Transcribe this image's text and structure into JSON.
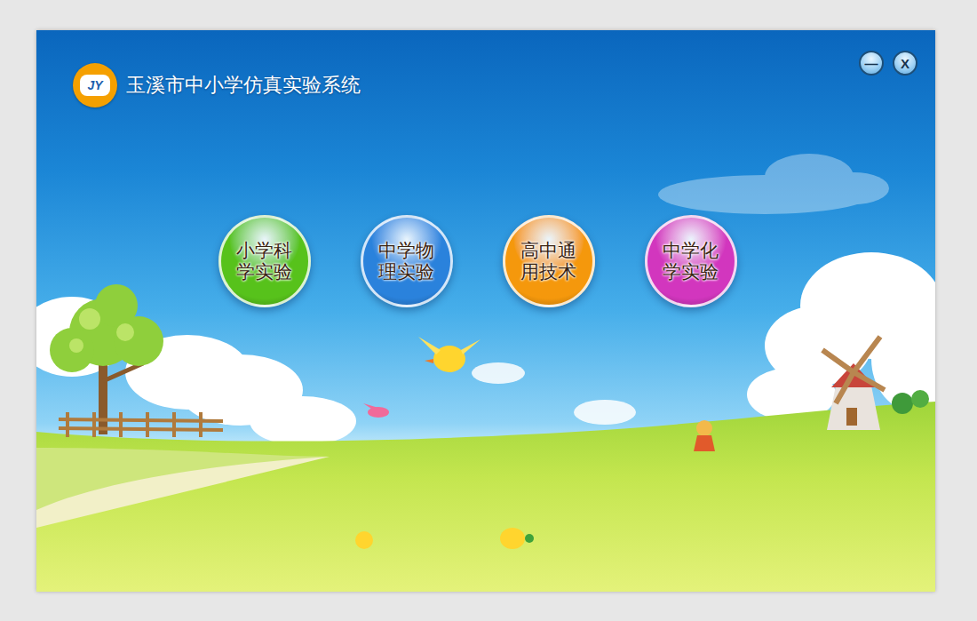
{
  "window": {
    "title": "玉溪市中小学仿真实验系统",
    "logo": "JY"
  },
  "controls": [
    {
      "label": "—"
    },
    {
      "label": "X"
    }
  ],
  "menu": [
    {
      "label": "小学科学实验",
      "color": "#57c21b"
    },
    {
      "label": "中学物理实验",
      "color": "#2a82dc"
    },
    {
      "label": "高中通用技术",
      "color": "#f5980c"
    },
    {
      "label": "中学化学实验",
      "color": "#d236be"
    }
  ]
}
